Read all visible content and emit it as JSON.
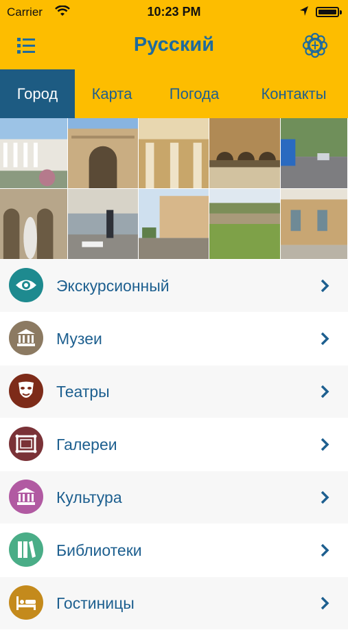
{
  "status_bar": {
    "carrier": "Carrier",
    "time": "10:23 PM"
  },
  "header": {
    "title": "Русский",
    "menu_icon": "list-menu-icon",
    "settings_icon": "coat-of-arms-icon",
    "colors": {
      "bar": "#fdbd00",
      "title": "#1f6b9c"
    }
  },
  "tabs": [
    {
      "label": "Город",
      "active": true
    },
    {
      "label": "Карта",
      "active": false
    },
    {
      "label": "Погода",
      "active": false
    },
    {
      "label": "Контакты",
      "active": false
    }
  ],
  "photo_grid": {
    "rows": 2,
    "columns": 5
  },
  "categories": [
    {
      "label": "Экскурсионный",
      "icon": "eye-icon",
      "color": "#1e8a8f"
    },
    {
      "label": "Музеи",
      "icon": "museum-icon",
      "color": "#8c7a62"
    },
    {
      "label": "Театры",
      "icon": "theatre-mask-icon",
      "color": "#7d2b19"
    },
    {
      "label": "Галереи",
      "icon": "picture-frame-icon",
      "color": "#7a3237"
    },
    {
      "label": "Культура",
      "icon": "culture-building-icon",
      "color": "#b15aa2"
    },
    {
      "label": "Библиотеки",
      "icon": "books-icon",
      "color": "#4aad87"
    },
    {
      "label": "Гостиницы",
      "icon": "bed-icon",
      "color": "#c48a1c"
    }
  ]
}
